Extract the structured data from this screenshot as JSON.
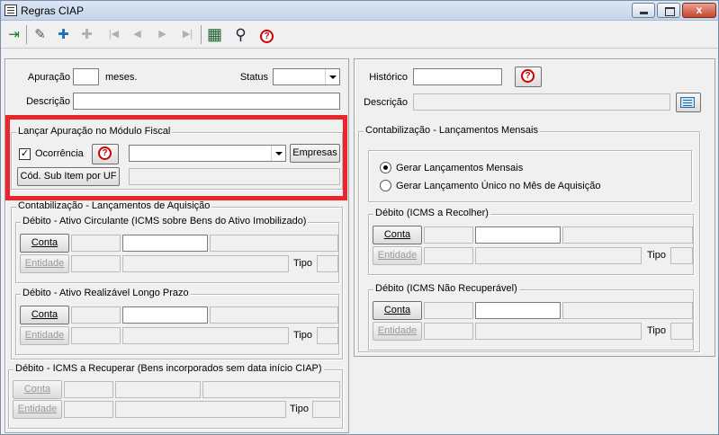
{
  "window": {
    "title": "Regras CIAP",
    "close_label": "x"
  },
  "toolbar": {
    "items": [
      {
        "icon": "exit-icon",
        "glyph": "⇥"
      },
      {
        "icon": "edit-icon",
        "glyph": "✎"
      },
      {
        "icon": "add-icon",
        "glyph": "✚"
      },
      {
        "icon": "remove-icon",
        "glyph": "✚"
      },
      {
        "icon": "first-icon",
        "glyph": "|◀"
      },
      {
        "icon": "prev-icon",
        "glyph": "◀"
      },
      {
        "icon": "next-icon",
        "glyph": "▶"
      },
      {
        "icon": "last-icon",
        "glyph": "▶|"
      },
      {
        "icon": "list-icon",
        "glyph": "▦"
      },
      {
        "icon": "search-icon",
        "glyph": "⚲"
      },
      {
        "icon": "help-icon",
        "glyph": "?"
      }
    ]
  },
  "left": {
    "apuracao_label": "Apuração",
    "apuracao_value": "",
    "meses_label": "meses.",
    "status_label": "Status",
    "status_value": "",
    "descricao_label": "Descrição",
    "descricao_value": "",
    "lancar": {
      "legend": "Lançar Apuração no Módulo Fiscal",
      "ocorrencia_label": "Ocorrência",
      "ocorrencia_checked": "✓",
      "help_glyph": "?",
      "empresas_label": "Empresas",
      "cod_sub_item_label": "Cód. Sub Item por UF"
    },
    "aquisicao": {
      "legend": "Contabilização - Lançamentos de Aquisição",
      "ativo_circulante": {
        "legend": "Débito - Ativo Circulante (ICMS sobre Bens do Ativo Imobilizado)",
        "conta_label": "Conta",
        "entidade_label": "Entidade",
        "tipo_label": "Tipo"
      },
      "ativo_realizavel": {
        "legend": "Débito - Ativo Realizável Longo Prazo",
        "conta_label": "Conta",
        "entidade_label": "Entidade",
        "tipo_label": "Tipo"
      }
    },
    "icms_recuperar": {
      "legend": "Débito - ICMS a Recuperar (Bens incorporados sem data início CIAP)",
      "conta_label": "Conta",
      "entidade_label": "Entidade",
      "tipo_label": "Tipo"
    }
  },
  "right": {
    "historico_label": "Histórico",
    "historico_value": "",
    "help_glyph": "?",
    "descricao_label": "Descrição",
    "mensais": {
      "legend": "Contabilização - Lançamentos Mensais",
      "opt1": "Gerar Lançamentos Mensais",
      "opt2": "Gerar Lançamento Único no Mês de Aquisição",
      "selected_option": 1
    },
    "icms_recolher": {
      "legend": "Débito (ICMS a Recolher)",
      "conta_label": "Conta",
      "entidade_label": "Entidade",
      "tipo_label": "Tipo"
    },
    "icms_nao_recuperavel": {
      "legend": "Débito (ICMS Não Recuperável)",
      "conta_label": "Conta",
      "entidade_label": "Entidade",
      "tipo_label": "Tipo"
    }
  },
  "colors": {
    "highlight": "#e8262b",
    "help": "#cc0000"
  }
}
